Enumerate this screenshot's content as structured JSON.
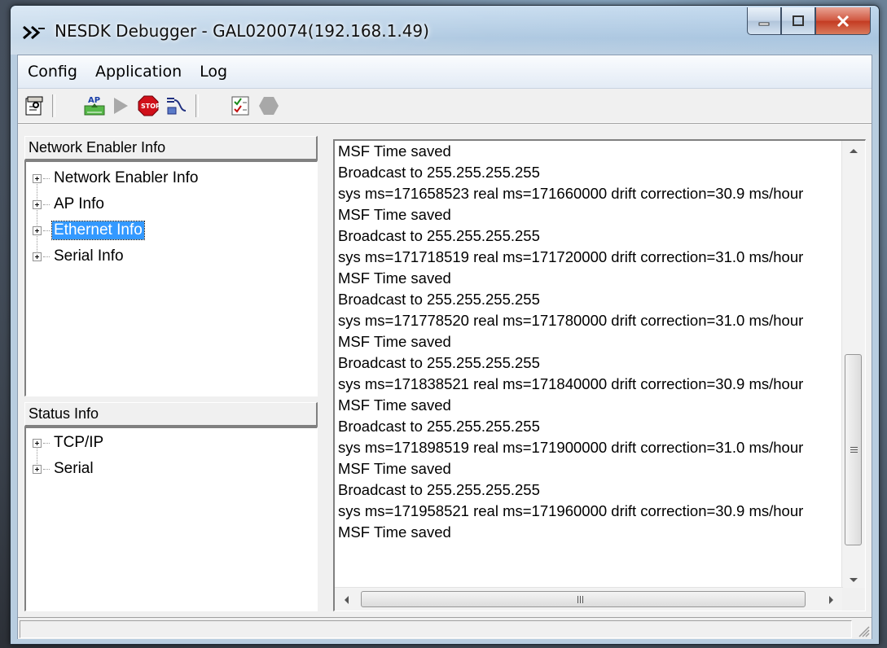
{
  "window": {
    "title": "NESDK Debugger - GAL020074(192.168.1.49)",
    "colors": {
      "title_gradient_top": "#c7dcef",
      "close_button": "#c33a21",
      "selection": "#3399ff"
    }
  },
  "menu": {
    "items": [
      "Config",
      "Application",
      "Log"
    ]
  },
  "toolbar": {
    "buttons": [
      "properties-icon",
      "ap-load-icon",
      "play-icon",
      "stop-icon",
      "connect-icon",
      "checklist-icon",
      "hexagon-icon"
    ]
  },
  "network_panel": {
    "header": "Network Enabler Info",
    "items": [
      {
        "label": "Network Enabler Info",
        "expanded": false
      },
      {
        "label": "AP Info",
        "expanded": false
      },
      {
        "label": "Ethernet Info",
        "expanded": false,
        "selected": true
      },
      {
        "label": "Serial Info",
        "expanded": false
      }
    ]
  },
  "status_panel": {
    "header": "Status Info",
    "items": [
      {
        "label": "TCP/IP",
        "expanded": false
      },
      {
        "label": "Serial",
        "expanded": false
      }
    ]
  },
  "log": {
    "lines": [
      "MSF Time saved",
      "Broadcast to 255.255.255.255",
      "sys ms=171658523 real ms=171660000 drift correction=30.9 ms/hour",
      "MSF Time saved",
      "Broadcast to 255.255.255.255",
      "sys ms=171718519 real ms=171720000 drift correction=31.0 ms/hour",
      "MSF Time saved",
      "Broadcast to 255.255.255.255",
      "sys ms=171778520 real ms=171780000 drift correction=31.0 ms/hour",
      "MSF Time saved",
      "Broadcast to 255.255.255.255",
      "sys ms=171838521 real ms=171840000 drift correction=30.9 ms/hour",
      "MSF Time saved",
      "Broadcast to 255.255.255.255",
      "sys ms=171898519 real ms=171900000 drift correction=31.0 ms/hour",
      "MSF Time saved",
      "Broadcast to 255.255.255.255",
      "sys ms=171958521 real ms=171960000 drift correction=30.9 ms/hour",
      "MSF Time saved"
    ]
  },
  "statusbar": {
    "text": ""
  }
}
